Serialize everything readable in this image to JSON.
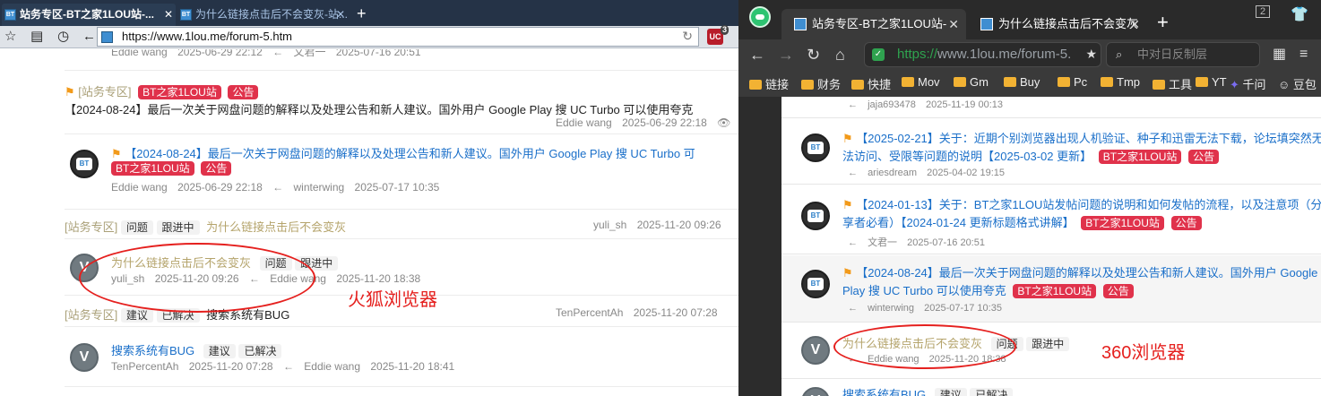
{
  "firefox": {
    "tabs": [
      {
        "label": "站务专区-BT之家1LOU站-...",
        "close": "✕"
      },
      {
        "label": "为什么链接点击后不会变灰-站...",
        "close": "✕"
      }
    ],
    "new_tab": "+",
    "url": "https://www.1lou.me/forum-5.htm",
    "addon_badge": "UC",
    "addon_count": "3",
    "rows": {
      "r1": {
        "author": "Eddie wang",
        "date": "2025-06-29 22:12",
        "arrow": "←",
        "last_user": "文君一",
        "last_date": "2025-07-16 20:51"
      },
      "r2": {
        "bracket": "[站务专区]",
        "tag1": "BT之家1LOU站",
        "tag2": "公告",
        "title": "【2024-08-24】最后一次关于网盘问题的解释以及处理公告和新人建议。国外用户 Google Play 搜 UC Turbo 可以使用夸克",
        "meta_user": "Eddie wang",
        "meta_date": "2025-06-29 22:18"
      },
      "r3": {
        "title": "【2024-08-24】最后一次关于网盘问题的解释以及处理公告和新人建议。国外用户 Google Play 搜 UC Turbo 可",
        "tag1": "BT之家1LOU站",
        "tag2": "公告",
        "author": "Eddie wang",
        "date": "2025-06-29 22:18",
        "arrow": "←",
        "last_user": "winterwing",
        "last_date": "2025-07-17 10:35"
      },
      "r4": {
        "bracket": "[站务专区]",
        "tag1": "问题",
        "tag2": "跟进中",
        "title": "为什么链接点击后不会变灰",
        "user": "yuli_sh",
        "date": "2025-11-20 09:26"
      },
      "r5": {
        "title": "为什么链接点击后不会变灰",
        "tag1": "问题",
        "tag2": "跟进中",
        "author": "yuli_sh",
        "date": "2025-11-20 09:26",
        "arrow": "←",
        "last_user": "Eddie wang",
        "last_date": "2025-11-20 18:38"
      },
      "r6": {
        "bracket": "[站务专区]",
        "tag1": "建议",
        "tag2": "已解决",
        "title": "搜索系统有BUG",
        "user": "TenPercentAh",
        "date": "2025-11-20 07:28"
      },
      "r7": {
        "title": "搜索系统有BUG",
        "tag1": "建议",
        "tag2": "已解决",
        "author": "TenPercentAh",
        "date": "2025-11-20 07:28",
        "arrow": "←",
        "last_user": "Eddie wang",
        "last_date": "2025-11-20 18:41"
      }
    },
    "annotation": "火狐浏览器"
  },
  "qh360": {
    "tabs": [
      {
        "label": "站务专区-BT之家1LOU站-",
        "close": "✕"
      },
      {
        "label": "为什么链接点击后不会变灰",
        "close": "✕"
      }
    ],
    "new_tab": "+",
    "window_badge": "2",
    "url_green": "https://",
    "url_rest": "www.1lou.me/forum-5.",
    "search_placeholder": "中对日反制层",
    "bookmarks": [
      "链接",
      "财务",
      "快捷",
      "Mov",
      "Gm",
      "Buy",
      "Pc",
      "Tmp",
      "工具",
      "YT",
      "千问",
      "豆包"
    ],
    "rows": {
      "q1": {
        "arrow": "←",
        "user": "jaja693478",
        "date": "2025-11-19 00:13"
      },
      "q2": {
        "title": "【2025-02-21】关于：近期个别浏览器出现人机验证、种子和迅雷无法下载，论坛填突然无法访问、受限等问题的说明【2025-03-02 更新】",
        "tag1": "BT之家1LOU站",
        "tag2": "公告",
        "arrow": "←",
        "user": "ariesdream",
        "date": "2025-04-02 19:15"
      },
      "q3": {
        "title": "【2024-01-13】关于：BT之家1LOU站发帖问题的说明和如何发帖的流程，以及注意项（分享者必看）【2024-01-24 更新标题格式讲解】",
        "tag1": "BT之家1LOU站",
        "tag2": "公告",
        "arrow": "←",
        "user": "文君一",
        "date": "2025-07-16 20:51"
      },
      "q4": {
        "title": "【2024-08-24】最后一次关于网盘问题的解释以及处理公告和新人建议。国外用户 Google Play 搜 UC Turbo 可以使用夸克",
        "tag1": "BT之家1LOU站",
        "tag2": "公告",
        "arrow": "←",
        "user": "winterwing",
        "date": "2025-07-17 10:35"
      },
      "q5": {
        "title": "为什么链接点击后不会变灰",
        "tag1": "问题",
        "tag2": "跟进中",
        "arrow": "←",
        "user": "Eddie wang",
        "date": "2025-11-20 18:38"
      },
      "q6": {
        "title": "搜索系统有BUG",
        "tag1": "建议",
        "tag2": "已解决"
      }
    },
    "annotation": "360浏览器"
  }
}
